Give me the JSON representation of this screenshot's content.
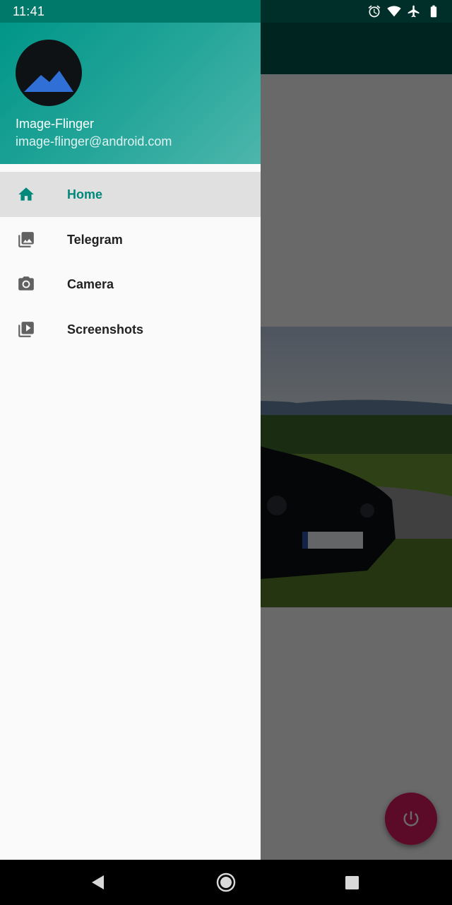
{
  "status_bar": {
    "time": "11:41",
    "icons": [
      "alarm-icon",
      "wifi-icon",
      "airplane-icon",
      "battery-icon"
    ]
  },
  "drawer": {
    "header": {
      "name": "Image-Flinger",
      "email": "image-flinger@android.com"
    },
    "items": [
      {
        "label": "Home",
        "icon": "home-icon",
        "active": true
      },
      {
        "label": "Telegram",
        "icon": "photo-library-icon",
        "active": false
      },
      {
        "label": "Camera",
        "icon": "camera-icon",
        "active": false
      },
      {
        "label": "Screenshots",
        "icon": "video-library-icon",
        "active": false
      }
    ]
  },
  "fab": {
    "icon": "power-icon"
  },
  "navigation_bar": {
    "buttons": [
      "back-icon",
      "home-circle-icon",
      "recents-icon"
    ]
  },
  "colors": {
    "primary": "#009688",
    "primary_dark": "#00796b",
    "accent": "#d81b60",
    "active_text": "#00897b"
  }
}
